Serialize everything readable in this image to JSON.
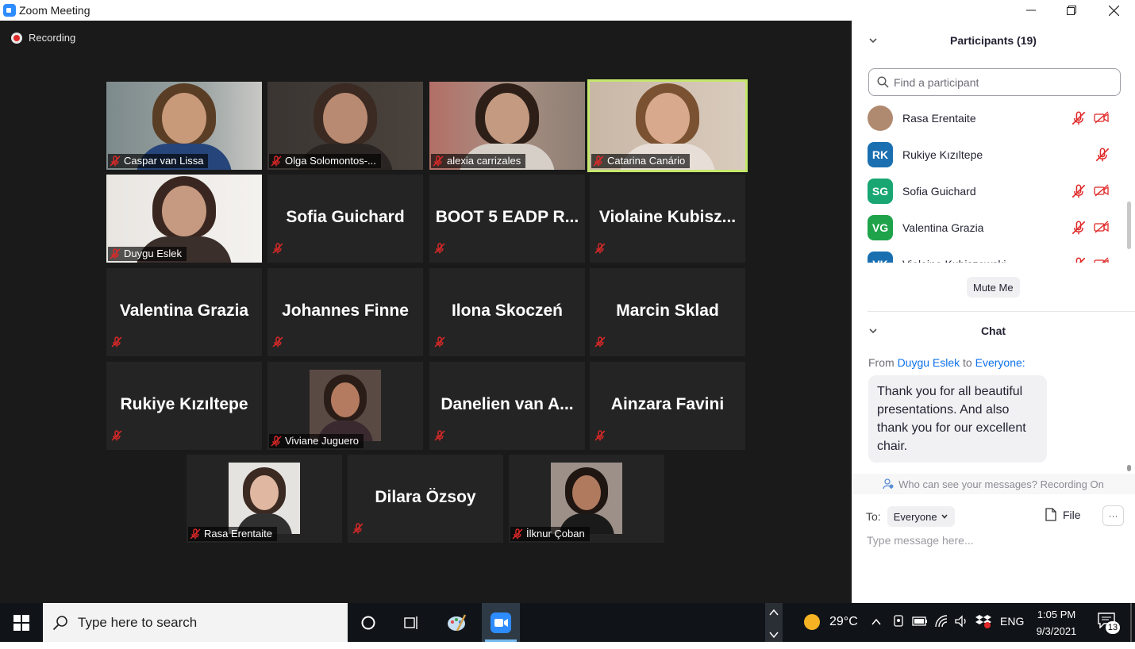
{
  "window": {
    "title": "Zoom Meeting"
  },
  "meeting": {
    "recording_label": "Recording",
    "tiles": [
      {
        "name": "Caspar van Lissa",
        "video": true
      },
      {
        "name": "Olga Solomontos-...",
        "video": true
      },
      {
        "name": "alexia carrizales",
        "video": true
      },
      {
        "name": "Catarina Canário",
        "video": true,
        "active": true
      },
      {
        "name": "Duygu Eslek",
        "video": true
      },
      {
        "name": "Sofia Guichard",
        "video": false
      },
      {
        "name": "BOOT 5 EADP R...",
        "video": false
      },
      {
        "name": "Violaine Kubisz...",
        "video": false
      },
      {
        "name": "Valentina Grazia",
        "video": false
      },
      {
        "name": "Johannes Finne",
        "video": false
      },
      {
        "name": "Ilona Skoczeń",
        "video": false
      },
      {
        "name": "Marcin Sklad",
        "video": false
      },
      {
        "name": "Rukiye Kızıltepe",
        "video": false
      },
      {
        "name": "Viviane Juguero",
        "video": true
      },
      {
        "name": "Danelien van A...",
        "video": false
      },
      {
        "name": "Ainzara Favini",
        "video": false
      },
      {
        "name": "Rasa Erentaite",
        "video": true
      },
      {
        "name": "Dilara Özsoy",
        "video": false
      },
      {
        "name": "İlknur Çoban",
        "video": true
      }
    ]
  },
  "participants": {
    "title": "Participants (19)",
    "search_placeholder": "Find a participant",
    "list": [
      {
        "name": "Rasa Erentaite",
        "initials": "",
        "color": "#b08a70",
        "cam_off": true
      },
      {
        "name": "Rukiye Kızıltepe",
        "initials": "RK",
        "color": "#1a6fb0",
        "cam_off": false
      },
      {
        "name": "Sofia Guichard",
        "initials": "SG",
        "color": "#18a673",
        "cam_off": true
      },
      {
        "name": "Valentina Grazia",
        "initials": "VG",
        "color": "#1fa34a",
        "cam_off": true
      },
      {
        "name": "Violaine Kubiszewski",
        "initials": "VK",
        "color": "#1a6fb0",
        "cam_off": true
      }
    ],
    "mute_me": "Mute Me"
  },
  "chat": {
    "title": "Chat",
    "from_prefix": "From",
    "from_name": "Duygu Eslek",
    "to_word": "to",
    "to_target": "Everyone:",
    "message": "Thank you for all beautiful presentations. And also thank you for our excellent chair.",
    "who_can_see": "Who can see your messages? Recording On",
    "to_label": "To:",
    "to_value": "Everyone",
    "file_label": "File",
    "more_label": "···",
    "input_placeholder": "Type message here..."
  },
  "taskbar": {
    "search_placeholder": "Type here to search",
    "weather": "29°C",
    "language": "ENG",
    "time": "1:05 PM",
    "date": "9/3/2021",
    "notifications": "13"
  },
  "colors": {
    "accent": "#0e72ed",
    "active_speaker": "#c5e86c",
    "mute_red": "#e02828"
  }
}
